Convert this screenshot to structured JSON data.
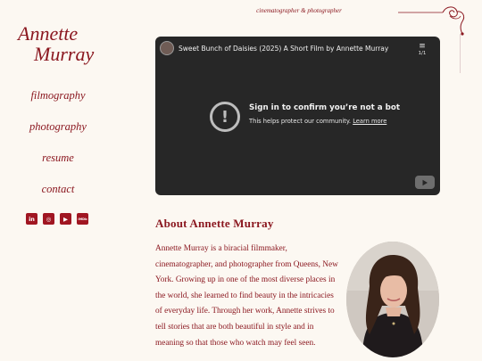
{
  "header": {
    "tagline": "cinematographer & photographer"
  },
  "logo": {
    "line1": "Annette",
    "line2": "Murray"
  },
  "nav": {
    "items": [
      {
        "label": "filmography"
      },
      {
        "label": "photography"
      },
      {
        "label": "resume"
      },
      {
        "label": "contact"
      }
    ]
  },
  "socials": [
    {
      "icon": "linkedin-icon",
      "glyph": "in"
    },
    {
      "icon": "instagram-icon",
      "glyph": "◎"
    },
    {
      "icon": "youtube-icon",
      "glyph": "▶"
    },
    {
      "icon": "imdb-icon",
      "glyph": "IMDb"
    }
  ],
  "video": {
    "title": "Sweet Bunch of Daisies (2025) A Short Film by Annette Murray",
    "playlist_count": "1/1",
    "message_heading": "Sign in to confirm you’re not a bot",
    "message_sub": "This helps protect our community.",
    "learn_more": "Learn more"
  },
  "about": {
    "title": "About Annette Murray",
    "body": "Annette Murray is a biracial filmmaker, cinematographer, and photographer from Queens, New York. Growing up in one of the most diverse places in the world, she learned to find beauty in the intricacies of everyday life. Through her work, Annette strives to tell stories that are both beautiful in style and in meaning so that those who watch may feel seen."
  },
  "colors": {
    "accent": "#8b1820",
    "background": "#fcf8f2",
    "video_bg": "#272727"
  }
}
